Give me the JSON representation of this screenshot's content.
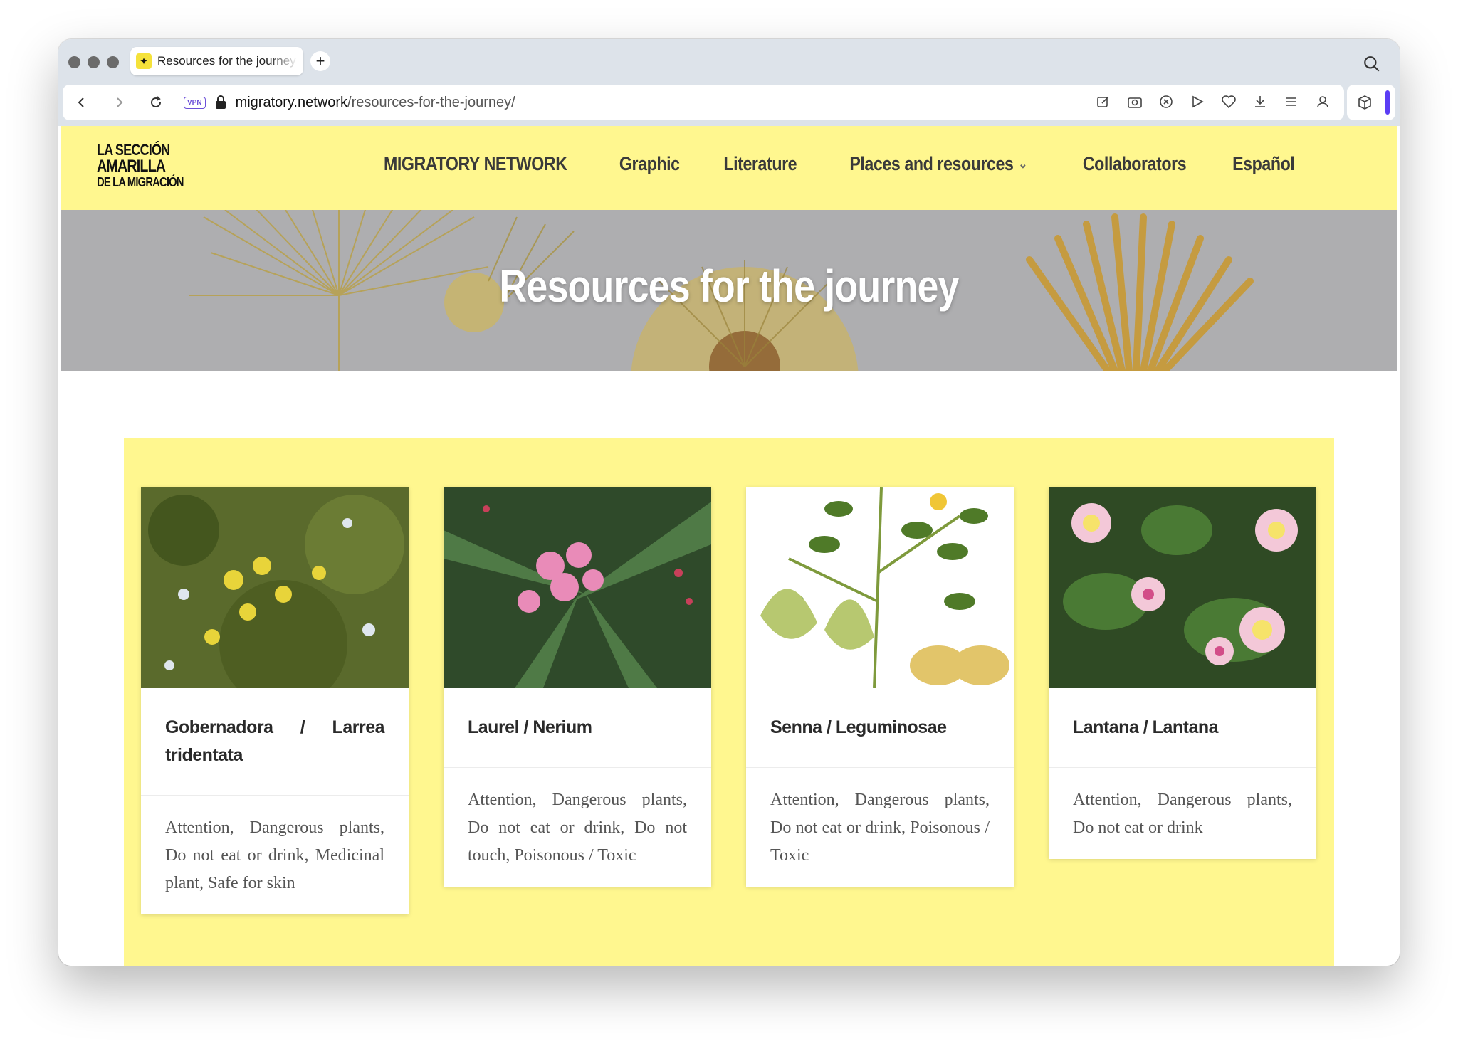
{
  "browser": {
    "tab_title": "Resources for the journey",
    "new_tab_label": "+",
    "vpn_badge": "VPN",
    "url_host": "migratory.network",
    "url_path": "/resources-for-the-journey/"
  },
  "site": {
    "logo_lines": [
      "LA SECCIÓN",
      "AMARILLA",
      "DE LA MIGRACIÓN"
    ],
    "nav": [
      {
        "label": "MIGRATORY NETWORK"
      },
      {
        "label": "Graphic"
      },
      {
        "label": "Literature"
      },
      {
        "label": "Places and resources",
        "has_dropdown": true
      },
      {
        "label": "Collaborators"
      },
      {
        "label": "Español"
      }
    ],
    "brand_color": "#fff78f"
  },
  "hero": {
    "title": "Resources for the journey"
  },
  "cards": [
    {
      "title": "Gobernadora / Larrea tridentata",
      "tags": "Attention, Dangerous plants, Do not eat or drink, Medicinal plant, Safe for skin",
      "image": "yellow-flowering-shrub"
    },
    {
      "title": "Laurel / Nerium",
      "tags": "Attention, Dangerous plants, Do not eat or drink, Do not touch, Poisonous / Toxic",
      "image": "pink-oleander"
    },
    {
      "title": "Senna / Leguminosae",
      "tags": "Attention, Dangerous plants, Do not eat or drink, Poisonous / Toxic",
      "image": "botanical-illustration-senna"
    },
    {
      "title": "Lantana / Lantana",
      "tags": "Attention, Dangerous plants, Do not eat or drink",
      "image": "lantana-flowers"
    }
  ]
}
